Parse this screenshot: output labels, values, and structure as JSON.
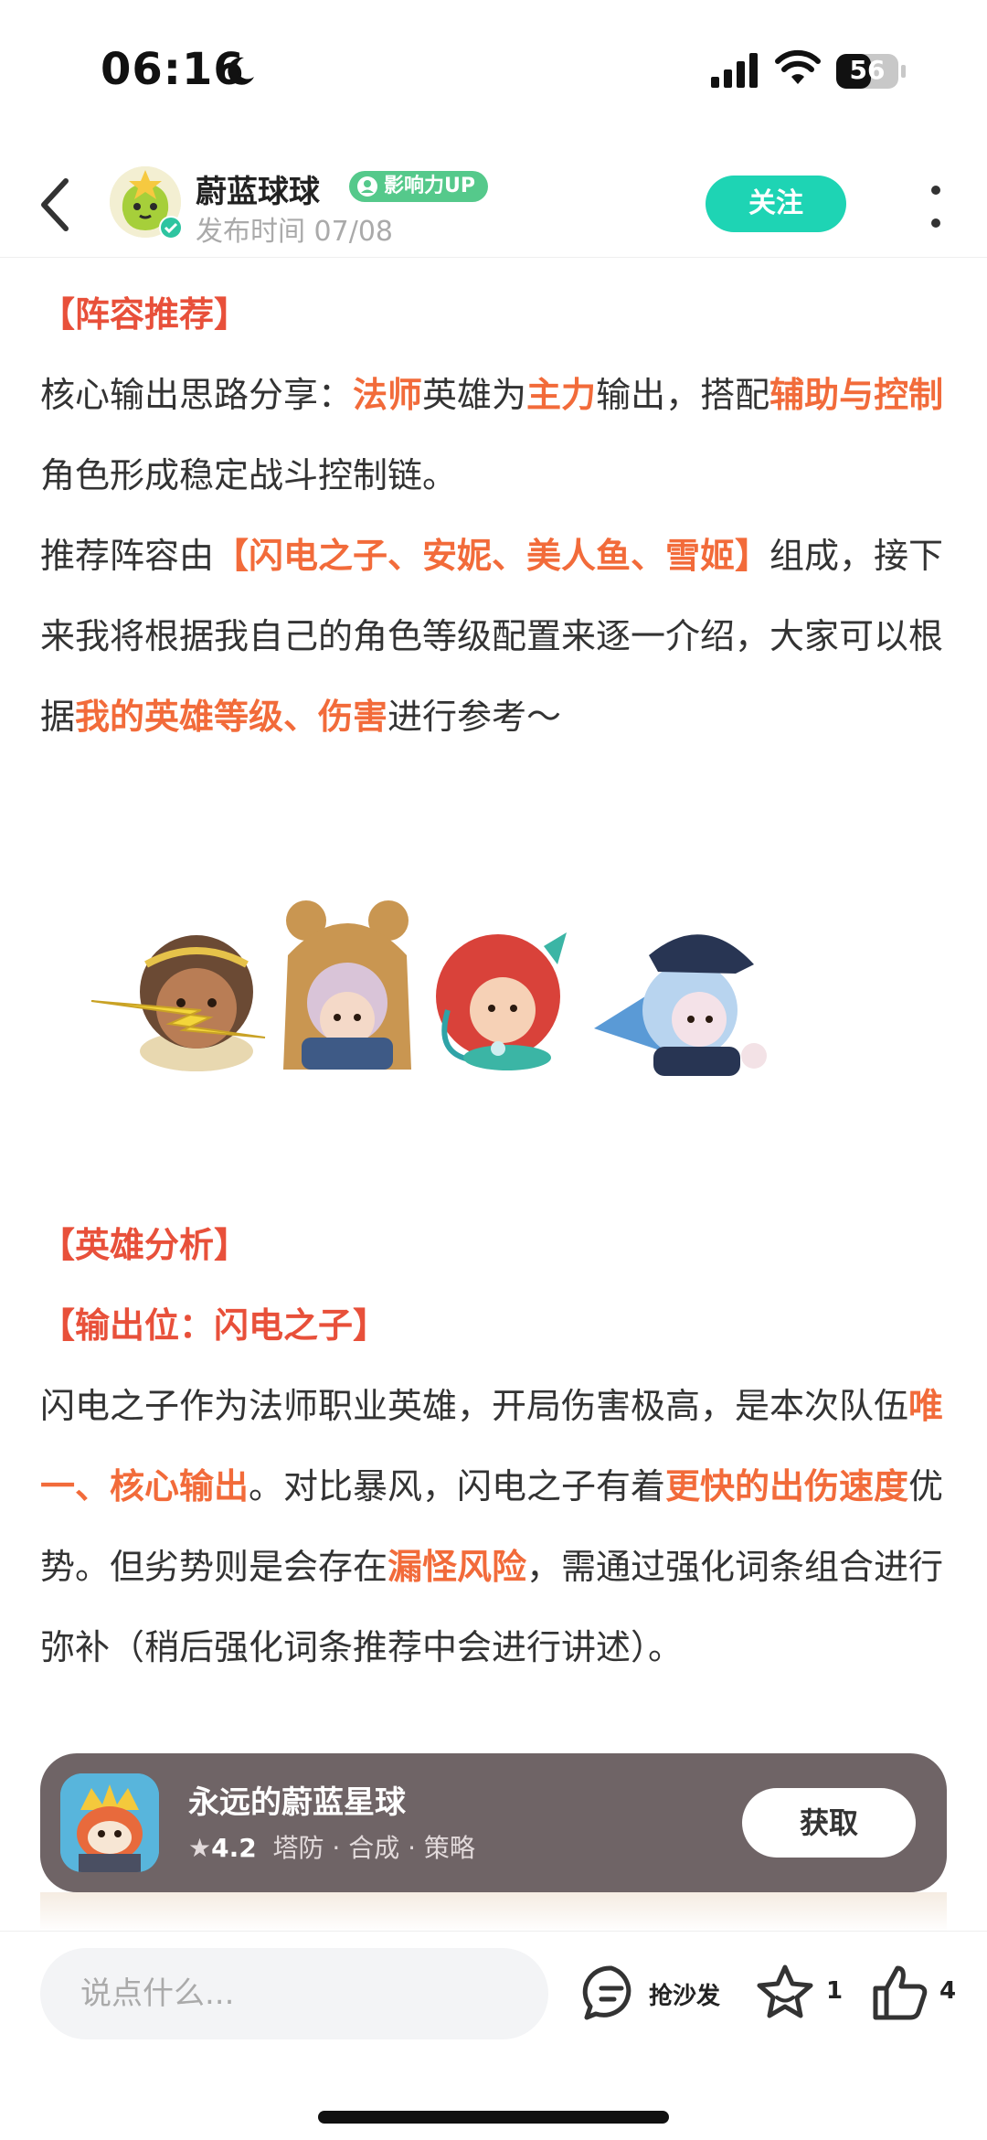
{
  "status_bar": {
    "time": "06:16",
    "battery": "56",
    "icons": [
      "moon-icon",
      "signal-icon",
      "wifi-icon",
      "battery-icon"
    ]
  },
  "header": {
    "author": "蔚蓝球球",
    "badge": "影响力UP",
    "publish_time": "发布时间 07/08",
    "follow_label": "关注",
    "icons": [
      "back-arrow-icon",
      "more-vertical-icon"
    ]
  },
  "article": {
    "lineup_heading": "【阵容推荐】",
    "p1": {
      "a": "核心输出思路分享：",
      "b": "法师",
      "c": "英雄为",
      "d": "主力",
      "e": "输出，搭配",
      "f": "辅助与控制",
      "g": "角色形成稳定战斗控制链。"
    },
    "p2": {
      "a": "推荐阵容由",
      "b": "【闪电之子、安妮、美人鱼、雪姬】",
      "c": "组成，接下来我将根据我自己的角色等级配置来逐一介绍，大家可以根据",
      "d": "我的英雄等级、伤害",
      "e": "进行参考～"
    },
    "analysis_heading": "【英雄分析】",
    "output_heading": "【输出位：闪电之子】",
    "p3": {
      "a": "闪电之子作为法师职业英雄，开局伤害极高，是本次队伍",
      "b": "唯一、核心输出",
      "c": "。对比暴风，闪电之子有着",
      "d": "更快的出伤速度",
      "e": "优势。但劣势则是会存在",
      "f": "漏怪风险",
      "g": "，需通过强化词条组合进行弥补（稍后强化词条推荐中会进行讲述）。"
    },
    "hero_icons": [
      "lightning-son-hero-icon",
      "annie-hero-icon",
      "mermaid-hero-icon",
      "yuki-hero-icon"
    ]
  },
  "app_card": {
    "name": "永远的蔚蓝星球",
    "rating": "4.2",
    "tags": "塔防 · 合成 · 策略",
    "get_label": "获取"
  },
  "bottom_bar": {
    "comment_placeholder": "说点什么...",
    "sofa_label": "抢沙发",
    "favorite_count": "1",
    "like_count": "4"
  },
  "colors": {
    "accent_teal": "#1ed4b4",
    "section_red": "#e8503a",
    "highlight_orange": "#f26b3a",
    "badge_green": "#55c98b"
  }
}
